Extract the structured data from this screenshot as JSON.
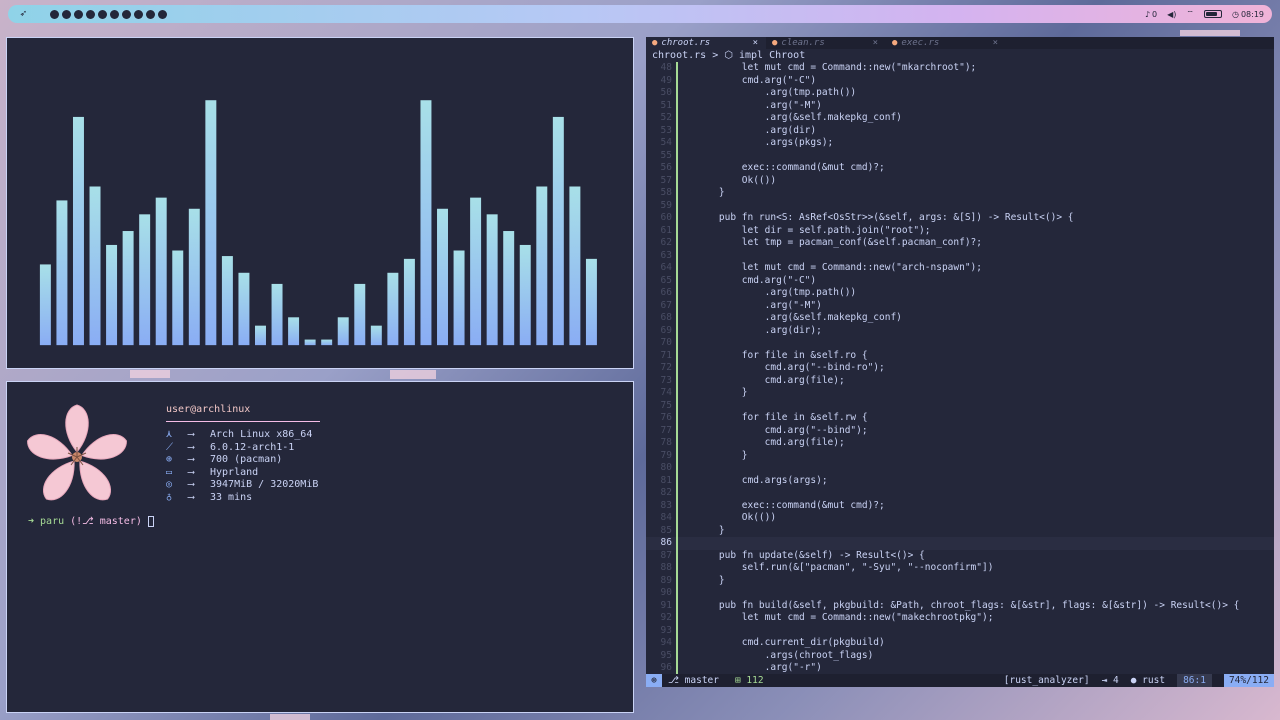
{
  "topbar": {
    "launcher_icon": "rocket-icon",
    "workspaces": 10,
    "notifications": "0",
    "time": "08:19",
    "battery_level": 0.8
  },
  "cava": {
    "bar_levels": [
      0.29,
      0.52,
      0.82,
      0.57,
      0.36,
      0.41,
      0.47,
      0.53,
      0.34,
      0.49,
      0.88,
      0.32,
      0.26,
      0.07,
      0.22,
      0.1,
      0.02,
      0.02,
      0.1,
      0.22,
      0.07,
      0.26,
      0.31,
      0.88,
      0.49,
      0.34,
      0.53,
      0.47,
      0.41,
      0.36,
      0.57,
      0.82,
      0.57,
      0.31
    ],
    "colors": {
      "top": "#a8e0e8",
      "bottom": "#8aadf4"
    }
  },
  "fetch": {
    "user": "user@archlinux",
    "rows": [
      {
        "icon": "arch-icon",
        "glyph": "⋏",
        "arrow": "⟶",
        "value": "Arch Linux x86_64"
      },
      {
        "icon": "kernel-icon",
        "glyph": "⟋",
        "arrow": "⟶",
        "value": "6.0.12-arch1-1"
      },
      {
        "icon": "package-icon",
        "glyph": "⊕",
        "arrow": "⟶",
        "value": "700 (pacman)"
      },
      {
        "icon": "monitor-icon",
        "glyph": "▭",
        "arrow": "⟶",
        "value": "Hyprland"
      },
      {
        "icon": "memory-icon",
        "glyph": "◎",
        "arrow": "⟶",
        "value": "3947MiB / 32020MiB"
      },
      {
        "icon": "clock-icon",
        "glyph": "♁",
        "arrow": "⟶",
        "value": "33 mins"
      }
    ],
    "prompt": {
      "arrow": "➜",
      "dir": "paru",
      "git": "(!⎇ master)"
    }
  },
  "editor": {
    "tabs": [
      {
        "label": "chroot.rs",
        "active": true
      },
      {
        "label": "clean.rs",
        "active": false
      },
      {
        "label": "exec.rs",
        "active": false
      }
    ],
    "breadcrumb": "chroot.rs > ⬡ impl Chroot",
    "lines": [
      {
        "n": "48",
        "t": "        let mut cmd = Command::new(\"mkarchroot\");"
      },
      {
        "n": "49",
        "t": "        cmd.arg(\"-C\")"
      },
      {
        "n": "50",
        "t": "            .arg(tmp.path())"
      },
      {
        "n": "51",
        "t": "            .arg(\"-M\")"
      },
      {
        "n": "52",
        "t": "            .arg(&self.makepkg_conf)"
      },
      {
        "n": "53",
        "t": "            .arg(dir)"
      },
      {
        "n": "54",
        "t": "            .args(pkgs);"
      },
      {
        "n": "55",
        "t": ""
      },
      {
        "n": "56",
        "t": "        exec::command(&mut cmd)?;"
      },
      {
        "n": "57",
        "t": "        Ok(())"
      },
      {
        "n": "58",
        "t": "    }"
      },
      {
        "n": "59",
        "t": ""
      },
      {
        "n": "60",
        "t": "    pub fn run<S: AsRef<OsStr>>(&self, args: &[S]) -> Result<()> {"
      },
      {
        "n": "61",
        "t": "        let dir = self.path.join(\"root\");"
      },
      {
        "n": "62",
        "t": "        let tmp = pacman_conf(&self.pacman_conf)?;"
      },
      {
        "n": "63",
        "t": ""
      },
      {
        "n": "64",
        "t": "        let mut cmd = Command::new(\"arch-nspawn\");"
      },
      {
        "n": "65",
        "t": "        cmd.arg(\"-C\")"
      },
      {
        "n": "66",
        "t": "            .arg(tmp.path())"
      },
      {
        "n": "67",
        "t": "            .arg(\"-M\")"
      },
      {
        "n": "68",
        "t": "            .arg(&self.makepkg_conf)"
      },
      {
        "n": "69",
        "t": "            .arg(dir);"
      },
      {
        "n": "70",
        "t": ""
      },
      {
        "n": "71",
        "t": "        for file in &self.ro {"
      },
      {
        "n": "72",
        "t": "            cmd.arg(\"--bind-ro\");"
      },
      {
        "n": "73",
        "t": "            cmd.arg(file);"
      },
      {
        "n": "74",
        "t": "        }"
      },
      {
        "n": "75",
        "t": ""
      },
      {
        "n": "76",
        "t": "        for file in &self.rw {"
      },
      {
        "n": "77",
        "t": "            cmd.arg(\"--bind\");"
      },
      {
        "n": "78",
        "t": "            cmd.arg(file);"
      },
      {
        "n": "79",
        "t": "        }"
      },
      {
        "n": "80",
        "t": ""
      },
      {
        "n": "81",
        "t": "        cmd.args(args);"
      },
      {
        "n": "82",
        "t": ""
      },
      {
        "n": "83",
        "t": "        exec::command(&mut cmd)?;"
      },
      {
        "n": "84",
        "t": "        Ok(())"
      },
      {
        "n": "85",
        "t": "    }"
      },
      {
        "n": "86",
        "t": ""
      },
      {
        "n": "87",
        "t": "    pub fn update(&self) -> Result<()> {"
      },
      {
        "n": "88",
        "t": "        self.run(&[\"pacman\", \"-Syu\", \"--noconfirm\"])"
      },
      {
        "n": "89",
        "t": "    }"
      },
      {
        "n": "90",
        "t": ""
      },
      {
        "n": "91",
        "t": "    pub fn build(&self, pkgbuild: &Path, chroot_flags: &[&str], flags: &[&str]) -> Result<()> {"
      },
      {
        "n": "92",
        "t": "        let mut cmd = Command::new(\"makechrootpkg\");"
      },
      {
        "n": "93",
        "t": ""
      },
      {
        "n": "94",
        "t": "        cmd.current_dir(pkgbuild)"
      },
      {
        "n": "95",
        "t": "            .args(chroot_flags)"
      },
      {
        "n": "96",
        "t": "            .arg(\"-r\")"
      }
    ],
    "current_line": "86",
    "status": {
      "mode": "⊛",
      "branch": "⎇ master",
      "diff": "⊞ 112",
      "lsp": "[rust_analyzer]",
      "indent": "⇥ 4",
      "lang": "● rust",
      "pos": "86:1",
      "pct": "74%/112"
    }
  }
}
